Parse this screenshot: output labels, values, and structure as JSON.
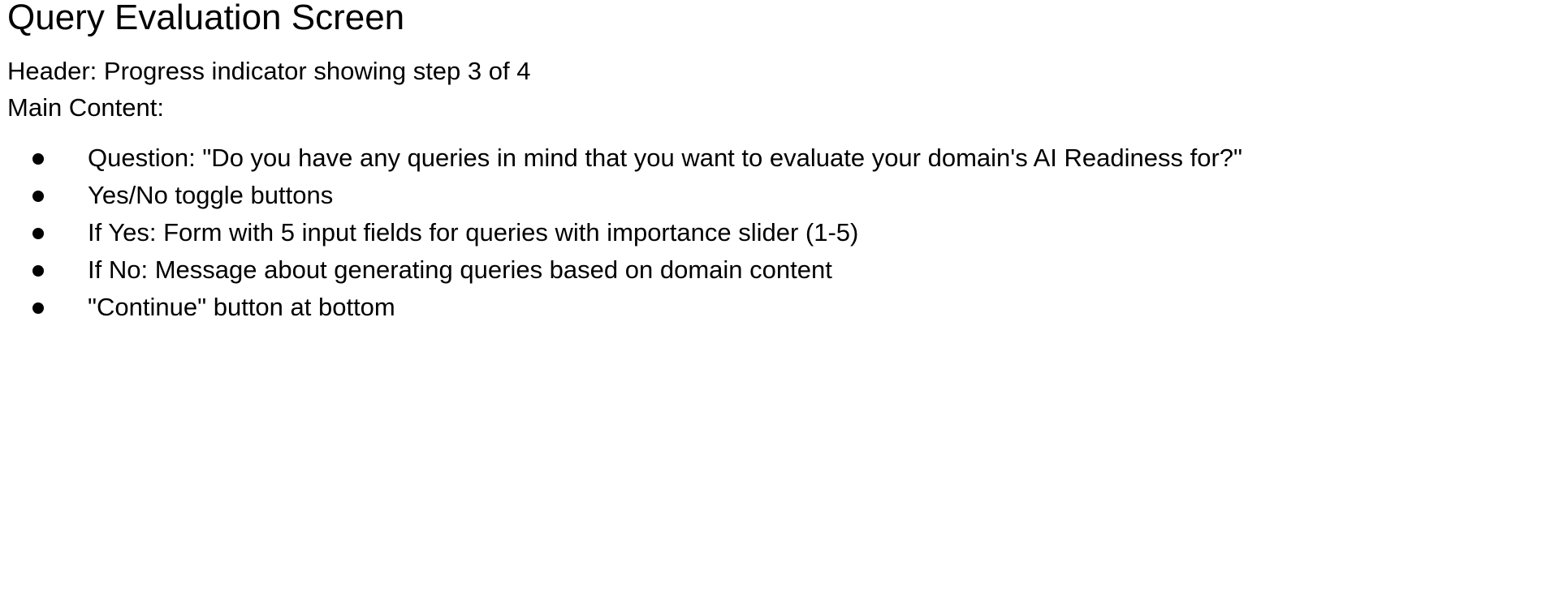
{
  "document": {
    "title": "Query Evaluation Screen",
    "header_line": "Header: Progress indicator showing step 3 of 4",
    "main_content_label": "Main Content:",
    "bullets": [
      "Question: \"Do you have any queries in mind that you want to evaluate your domain's AI Readiness for?\"",
      "Yes/No toggle buttons",
      "If Yes: Form with 5 input fields for queries with importance slider (1-5)",
      "If No: Message about generating queries based on domain content",
      "\"Continue\" button at bottom"
    ]
  }
}
